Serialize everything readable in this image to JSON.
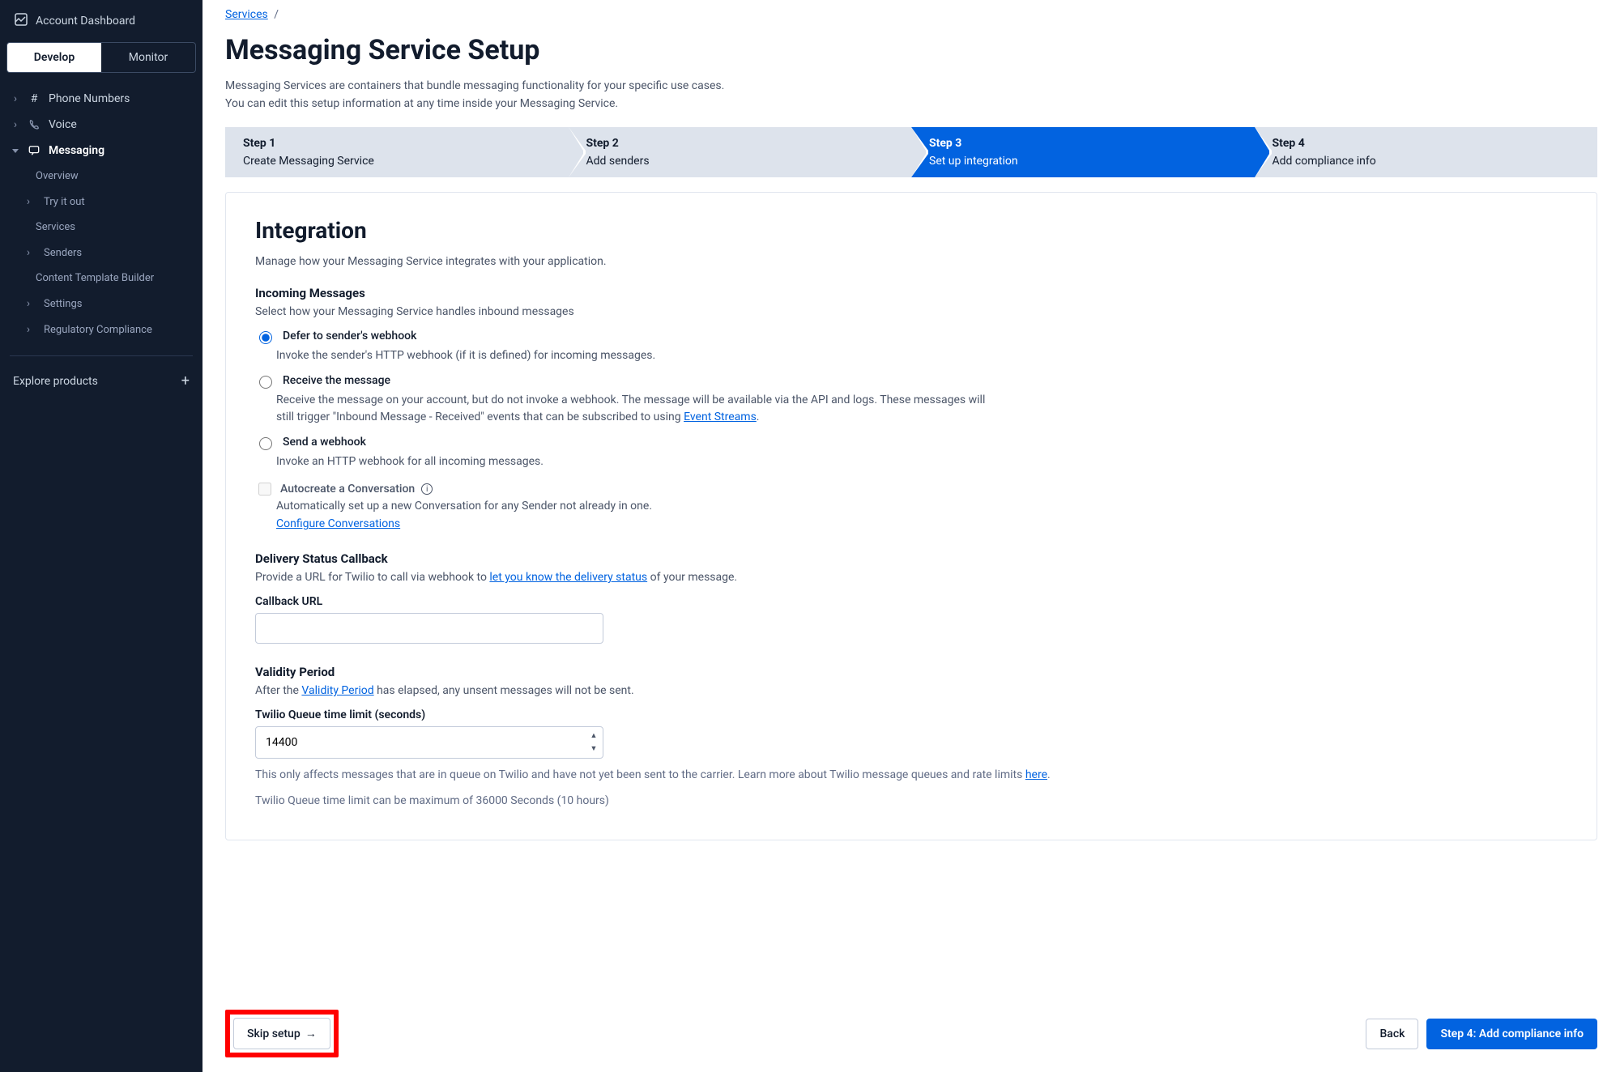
{
  "sidebar": {
    "account": "Account Dashboard",
    "tabs": {
      "develop": "Develop",
      "monitor": "Monitor"
    },
    "phone": "Phone Numbers",
    "voice": "Voice",
    "messaging": "Messaging",
    "messaging_sub": {
      "overview": "Overview",
      "tryitout": "Try it out",
      "services": "Services",
      "senders": "Senders",
      "ctb": "Content Template Builder",
      "settings": "Settings",
      "regcomp": "Regulatory Compliance"
    },
    "explore": "Explore products"
  },
  "breadcrumb": {
    "services": "Services",
    "sep": "/"
  },
  "title": "Messaging Service Setup",
  "desc1": "Messaging Services are containers that bundle messaging functionality for your specific use cases.",
  "desc2": "You can edit this setup information at any time inside your Messaging Service.",
  "steps": [
    {
      "num": "Step 1",
      "lbl": "Create Messaging Service"
    },
    {
      "num": "Step 2",
      "lbl": "Add senders"
    },
    {
      "num": "Step 3",
      "lbl": "Set up integration"
    },
    {
      "num": "Step 4",
      "lbl": "Add compliance info"
    }
  ],
  "card": {
    "title": "Integration",
    "sub": "Manage how your Messaging Service integrates with your application.",
    "incoming_title": "Incoming Messages",
    "incoming_desc": "Select how your Messaging Service handles inbound messages",
    "opt1": {
      "label": "Defer to sender's webhook",
      "help": "Invoke the sender's HTTP webhook (if it is defined) for incoming messages."
    },
    "opt2": {
      "label": "Receive the message",
      "help_a": "Receive the message on your account, but do not invoke a webhook. The message will be available via the API and logs. These messages will still trigger \"Inbound Message - Received\" events that can be subscribed to using ",
      "help_link": "Event Streams",
      "help_b": "."
    },
    "opt3": {
      "label": "Send a webhook",
      "help": "Invoke an HTTP webhook for all incoming messages."
    },
    "conv": {
      "label": "Autocreate a Conversation",
      "help": "Automatically set up a new Conversation for any Sender not already in one.",
      "link": "Configure Conversations"
    },
    "dsc_title": "Delivery Status Callback",
    "dsc_desc_a": "Provide a URL for Twilio to call via webhook to ",
    "dsc_desc_link": "let you know the delivery status",
    "dsc_desc_b": " of your message.",
    "callback_label": "Callback URL",
    "vp_title": "Validity Period",
    "vp_desc_a": "After the ",
    "vp_desc_link": "Validity Period",
    "vp_desc_b": " has elapsed, any unsent messages will not be sent.",
    "queue_label": "Twilio Queue time limit (seconds)",
    "queue_value": "14400",
    "queue_help_a": "This only affects messages that are in queue on Twilio and have not yet been sent to the carrier. Learn more about Twilio message queues and rate limits ",
    "queue_help_link": "here",
    "queue_help_b": ".",
    "queue_help2": "Twilio Queue time limit can be maximum of 36000 Seconds (10 hours)"
  },
  "footer": {
    "skip": "Skip setup",
    "back": "Back",
    "next": "Step 4: Add compliance info"
  }
}
